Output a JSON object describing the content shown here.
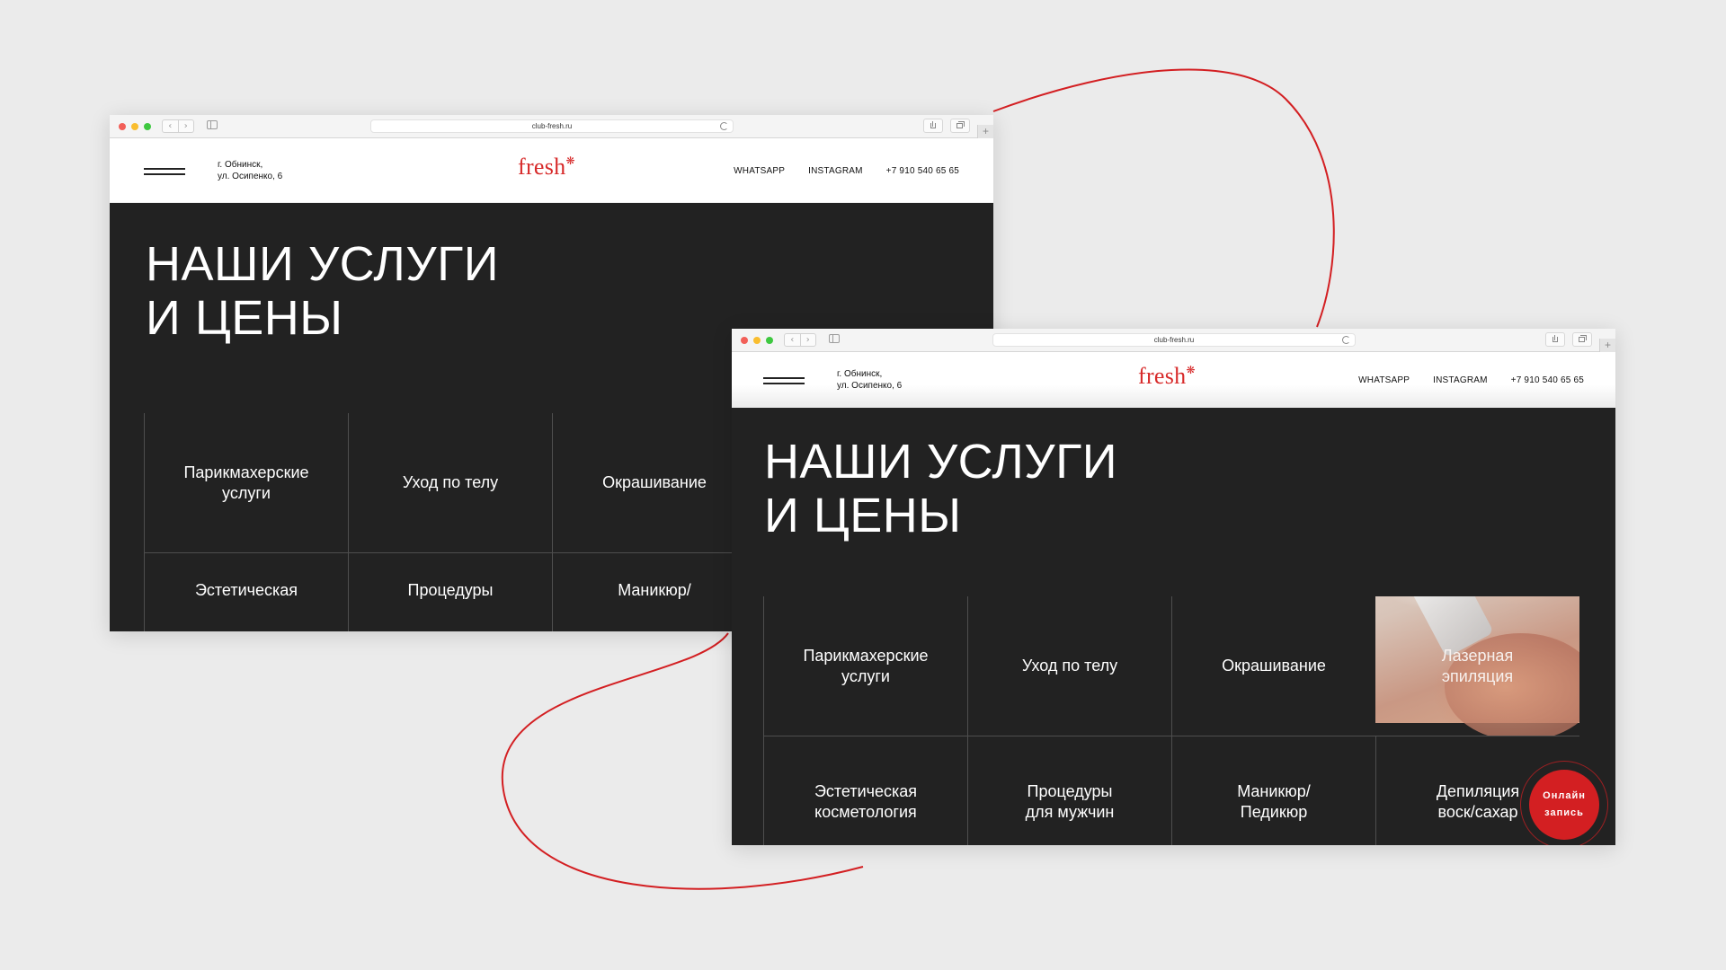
{
  "browser": {
    "url": "club-fresh.ru",
    "nav_back": "‹",
    "nav_forward": "›",
    "new_tab": "+"
  },
  "header": {
    "address_line1": "г. Обнинск,",
    "address_line2": "ул. Осипенко, 6",
    "logo_text": "fresh",
    "logo_mark": "❋",
    "links": [
      "WHATSAPP",
      "INSTAGRAM",
      "+7 910 540 65 65"
    ]
  },
  "hero": {
    "title_line1": "НАШИ УСЛУГИ",
    "title_line2": "И ЦЕНЫ"
  },
  "services": [
    "Парикмахерские\nуслуги",
    "Уход по телу",
    "Окрашивание",
    "Лазерная\nэпиляция",
    "Эстетическая\nкосметология",
    "Процедуры\nдля мужчин",
    "Маникюр/\nПедикюр",
    "Депиляция\nвоск/сахар"
  ],
  "services_window1_row2": [
    "Эстетическая",
    "Процедуры",
    "Маникюр/"
  ],
  "booking": {
    "line1": "Онлайн",
    "line2": "запись"
  },
  "colors": {
    "accent": "#d31f22",
    "dark_bg": "#222222",
    "page_bg": "#ebebeb"
  }
}
